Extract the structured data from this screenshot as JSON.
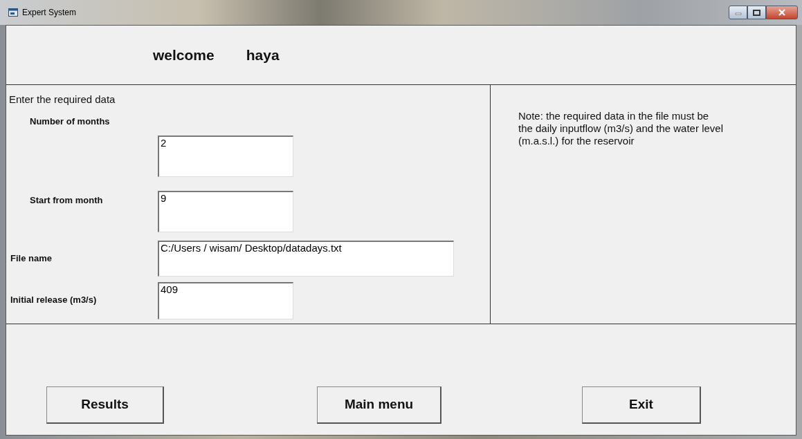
{
  "window": {
    "title": "Expert System"
  },
  "header": {
    "greeting": "welcome",
    "user": "haya"
  },
  "form": {
    "heading": "Enter the required data",
    "fields": [
      {
        "label": "Number of months",
        "value": "2",
        "kind": "short",
        "indented": true
      },
      {
        "label": "Start from month",
        "value": "9",
        "kind": "short",
        "indented": true
      },
      {
        "label": "File name",
        "value": "C:/Users / wisam/ Desktop/datadays.txt",
        "kind": "wide",
        "indented": false
      },
      {
        "label": "Initial release (m3/s)",
        "value": "409",
        "kind": "short",
        "indented": false
      }
    ]
  },
  "note": "Note: the required data in the file must be the daily inputflow (m3/s) and the water level (m.a.s.l.) for the reservoir",
  "buttons": [
    "Results",
    "Main menu",
    "Exit"
  ]
}
